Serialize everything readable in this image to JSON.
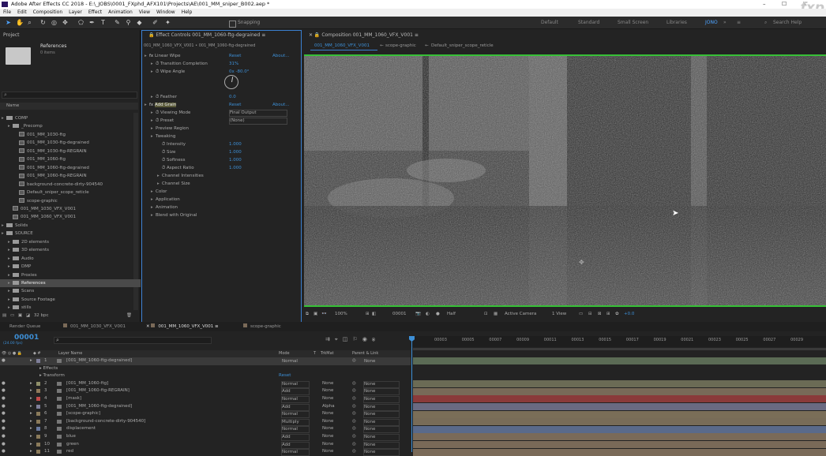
{
  "window": {
    "title": "Adobe After Effects CC 2018 - E:\\_JOBS\\0001_FXphd_AFX101\\Projects\\AE\\001_MM_sniper_B002.aep *",
    "watermark": "fxp"
  },
  "menu": [
    "File",
    "Edit",
    "Composition",
    "Layer",
    "Effect",
    "Animation",
    "View",
    "Window",
    "Help"
  ],
  "toolbar": {
    "snapping": "Snapping",
    "workspaces": [
      "Default",
      "Standard",
      "Small Screen",
      "Libraries",
      "JONO"
    ],
    "search": "Search Help"
  },
  "project": {
    "tab": "Project",
    "selected_name": "References",
    "selected_info": "0 items",
    "search_placeholder": "",
    "col_name": "Name",
    "rows": [
      {
        "label": "COMP",
        "kind": "folder",
        "indent": 0
      },
      {
        "label": "_Precomp",
        "kind": "folder",
        "indent": 1
      },
      {
        "label": "001_MM_1030-ftg",
        "kind": "comp",
        "indent": 2
      },
      {
        "label": "001_MM_1030-ftg-degrained",
        "kind": "comp",
        "indent": 2
      },
      {
        "label": "001_MM_1030-ftg-REGRAIN",
        "kind": "comp",
        "indent": 2
      },
      {
        "label": "001_MM_1060-ftg",
        "kind": "comp",
        "indent": 2
      },
      {
        "label": "001_MM_1060-ftg-degrained",
        "kind": "comp",
        "indent": 2
      },
      {
        "label": "001_MM_1060-ftg-REGRAIN",
        "kind": "comp",
        "indent": 2
      },
      {
        "label": "background-concrete-dirty-904540",
        "kind": "comp",
        "indent": 2
      },
      {
        "label": "Default_sniper_scope_reticle",
        "kind": "comp",
        "indent": 2
      },
      {
        "label": "scope-graphic",
        "kind": "comp",
        "indent": 2
      },
      {
        "label": "001_MM_1030_VFX_V001",
        "kind": "comp",
        "indent": 1
      },
      {
        "label": "001_MM_1060_VFX_V001",
        "kind": "comp",
        "indent": 1
      },
      {
        "label": "Solids",
        "kind": "folder",
        "indent": 0
      },
      {
        "label": "SOURCE",
        "kind": "folder",
        "indent": 0
      },
      {
        "label": "2D elements",
        "kind": "folder",
        "indent": 1
      },
      {
        "label": "3D elements",
        "kind": "folder",
        "indent": 1
      },
      {
        "label": "Audio",
        "kind": "folder",
        "indent": 1
      },
      {
        "label": "DMP",
        "kind": "folder",
        "indent": 1
      },
      {
        "label": "Proxies",
        "kind": "folder",
        "indent": 1
      },
      {
        "label": "References",
        "kind": "folder",
        "indent": 1
      },
      {
        "label": "Scans",
        "kind": "folder",
        "indent": 1
      },
      {
        "label": "Source Footage",
        "kind": "folder",
        "indent": 1
      },
      {
        "label": "stills",
        "kind": "folder",
        "indent": 1
      }
    ],
    "bpc": "32 bpc"
  },
  "effects": {
    "tab": "Effect Controls 001_MM_1060-ftg-degrained",
    "breadcrumb": "001_MM_1060_VFX_V001 • 001_MM_1060-ftg-degrained",
    "reset": "Reset",
    "about": "About...",
    "rows": [
      {
        "label": "Linear Wipe",
        "value": "",
        "fx": true,
        "indent": 0
      },
      {
        "label": "Transition Completion",
        "value": "31%",
        "indent": 1
      },
      {
        "label": "Wipe Angle",
        "value": "0x -80.0°",
        "indent": 1
      },
      {
        "label": "Feather",
        "value": "0.0",
        "indent": 1
      },
      {
        "label": "Add Grain",
        "value": "",
        "fx": true,
        "indent": 0
      },
      {
        "label": "Viewing Mode",
        "value": "Final Output",
        "indent": 1
      },
      {
        "label": "Preset",
        "value": "(None)",
        "indent": 1
      },
      {
        "label": "Preview Region",
        "value": "",
        "indent": 1
      },
      {
        "label": "Tweaking",
        "value": "",
        "indent": 1
      },
      {
        "label": "Intensity",
        "value": "1.000",
        "indent": 2
      },
      {
        "label": "Size",
        "value": "1.000",
        "indent": 2
      },
      {
        "label": "Softness",
        "value": "1.000",
        "indent": 2
      },
      {
        "label": "Aspect Ratio",
        "value": "1.000",
        "indent": 2
      },
      {
        "label": "Channel Intensities",
        "value": "",
        "indent": 2
      },
      {
        "label": "Channel Size",
        "value": "",
        "indent": 2
      },
      {
        "label": "Color",
        "value": "",
        "indent": 1
      },
      {
        "label": "Application",
        "value": "",
        "indent": 1
      },
      {
        "label": "Animation",
        "value": "",
        "indent": 1
      },
      {
        "label": "Blend with Original",
        "value": "",
        "indent": 1
      }
    ]
  },
  "composition": {
    "tab": "Composition 001_MM_1060_VFX_V001",
    "subtabs": [
      "001_MM_1060_VFX_V001",
      "scope-graphic",
      "Default_sniper_scope_reticle"
    ],
    "zoom": "100%",
    "time": "00001",
    "resolution": "Half",
    "camera": "Active Camera",
    "view": "1 View",
    "exposure": "+0.0"
  },
  "timeline": {
    "tabs": [
      "Render Queue",
      "001_MM_1030_VFX_V001",
      "001_MM_1060_VFX_V001",
      "scope-graphic"
    ],
    "timecode": "00001",
    "fps": "(24.00 fps)",
    "col_layer": "Layer Name",
    "col_mode": "Mode",
    "col_trkmat": "TrkMat",
    "col_parent": "Parent & Link",
    "ruler": [
      "00003",
      "00005",
      "00007",
      "00009",
      "00011",
      "00013",
      "00015",
      "00017",
      "00019",
      "00021",
      "00023",
      "00025",
      "00027",
      "00029"
    ],
    "sublayers": [
      "Effects",
      "Transform"
    ],
    "transform_reset": "Reset",
    "layers": [
      {
        "num": "1",
        "name": "[001_MM_1060-ftg-degrained]",
        "mode": "Normal",
        "trk": "",
        "parent": "None",
        "color": "#7f7f9a",
        "bar": "#5b6b55"
      },
      {
        "num": "2",
        "name": "[001_MM_1060-ftg]",
        "mode": "Normal",
        "trk": "None",
        "parent": "None",
        "color": "#8f8f6a",
        "bar": "#6b6b55"
      },
      {
        "num": "3",
        "name": "[001_MM_1060-ftg-REGRAIN]",
        "mode": "Add",
        "trk": "None",
        "parent": "None",
        "color": "#8f7a5a",
        "bar": "#786a58"
      },
      {
        "num": "4",
        "name": "[mask]",
        "mode": "Normal",
        "trk": "None",
        "parent": "None",
        "color": "#c24a4a",
        "bar": "#8a3a3a"
      },
      {
        "num": "5",
        "name": "[001_MM_1060-ftg-degrained]",
        "mode": "Add",
        "trk": "Alpha",
        "parent": "None",
        "color": "#7f7f9a",
        "bar": "#6a6a82"
      },
      {
        "num": "6",
        "name": "[scope-graphic]",
        "mode": "Normal",
        "trk": "None",
        "parent": "None",
        "color": "#8a7a5a",
        "bar": "#7a6e58"
      },
      {
        "num": "7",
        "name": "[background-concrete-dirty-904540]",
        "mode": "Multiply",
        "trk": "None",
        "parent": "None",
        "color": "#8a7a5a",
        "bar": "#786c58"
      },
      {
        "num": "8",
        "name": "displacement",
        "mode": "Normal",
        "trk": "None",
        "parent": "None",
        "color": "#6a7aa0",
        "bar": "#5a6a8a"
      },
      {
        "num": "9",
        "name": "blue",
        "mode": "Add",
        "trk": "None",
        "parent": "None",
        "color": "#8a7a5a",
        "bar": "#7a6a58"
      },
      {
        "num": "10",
        "name": "green",
        "mode": "Add",
        "trk": "None",
        "parent": "None",
        "color": "#8a7a5a",
        "bar": "#7a6a58"
      },
      {
        "num": "11",
        "name": "red",
        "mode": "Normal",
        "trk": "None",
        "parent": "None",
        "color": "#8a7a5a",
        "bar": "#7a6a58"
      }
    ]
  }
}
